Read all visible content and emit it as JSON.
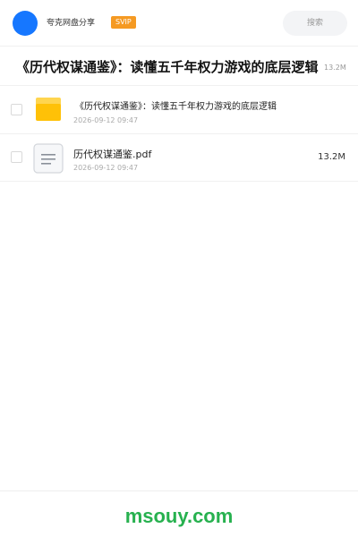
{
  "header": {
    "brand": "夸克网盘分享",
    "badge": "SVIP",
    "search_label": "搜索"
  },
  "title": {
    "text": "《历代权谋通鉴》：读懂五千年权力游戏的底层逻辑",
    "size": "13.2M"
  },
  "files": [
    {
      "icon": "folder-icon",
      "name": "《历代权谋通鉴》：读懂五千年权力游戏的底层逻辑",
      "date": "2026-09-12 09:47",
      "size": ""
    },
    {
      "icon": "document-icon",
      "name": "历代权谋通鉴.pdf",
      "date": "2026-09-12 09:47",
      "size": "13.2M"
    }
  ],
  "footer": {
    "watermark": "msouy.com"
  },
  "colors": {
    "avatar": "#1677ff",
    "badge": "#f59a23",
    "folder": "#ffc107",
    "watermark": "#27b14f"
  }
}
